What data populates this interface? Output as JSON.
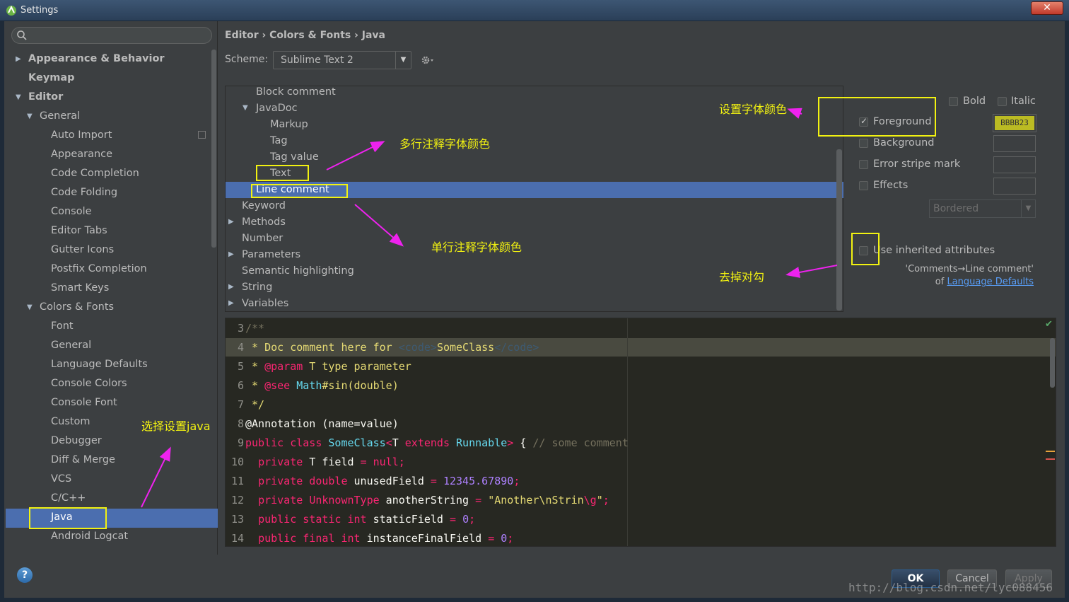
{
  "window": {
    "title": "Settings",
    "close_glyph": "✕"
  },
  "search": {
    "placeholder": ""
  },
  "tree": {
    "items": [
      {
        "label": "Appearance & Behavior",
        "bold": true,
        "level": 0,
        "arrow": "▶"
      },
      {
        "label": "Keymap",
        "bold": true,
        "level": 0,
        "arrow": ""
      },
      {
        "label": "Editor",
        "bold": true,
        "level": 0,
        "arrow": "▼"
      },
      {
        "label": "General",
        "bold": false,
        "level": 1,
        "arrow": "▼"
      },
      {
        "label": "Auto Import",
        "level": 2
      },
      {
        "label": "Appearance",
        "level": 2
      },
      {
        "label": "Code Completion",
        "level": 2
      },
      {
        "label": "Code Folding",
        "level": 2
      },
      {
        "label": "Console",
        "level": 2
      },
      {
        "label": "Editor Tabs",
        "level": 2
      },
      {
        "label": "Gutter Icons",
        "level": 2
      },
      {
        "label": "Postfix Completion",
        "level": 2
      },
      {
        "label": "Smart Keys",
        "level": 2
      },
      {
        "label": "Colors & Fonts",
        "level": 1,
        "arrow": "▼"
      },
      {
        "label": "Font",
        "level": 2
      },
      {
        "label": "General",
        "level": 2
      },
      {
        "label": "Language Defaults",
        "level": 2
      },
      {
        "label": "Console Colors",
        "level": 2
      },
      {
        "label": "Console Font",
        "level": 2
      },
      {
        "label": "Custom",
        "level": 2
      },
      {
        "label": "Debugger",
        "level": 2
      },
      {
        "label": "Diff & Merge",
        "level": 2
      },
      {
        "label": "VCS",
        "level": 2
      },
      {
        "label": "C/C++",
        "level": 2
      },
      {
        "label": "Java",
        "level": 2,
        "selected": true
      },
      {
        "label": "Android Logcat",
        "level": 2
      }
    ]
  },
  "breadcrumb": "Editor › Colors & Fonts › Java",
  "scheme": {
    "label": "Scheme:",
    "value": "Sublime Text 2"
  },
  "attributes": [
    {
      "label": "Block comment",
      "indent": 2
    },
    {
      "label": "JavaDoc",
      "indent": 2,
      "arrow": "▼"
    },
    {
      "label": "Markup",
      "indent": 3
    },
    {
      "label": "Tag",
      "indent": 3
    },
    {
      "label": "Tag value",
      "indent": 3
    },
    {
      "label": "Text",
      "indent": 3
    },
    {
      "label": "Line comment",
      "indent": 2,
      "selected": true
    },
    {
      "label": "Keyword",
      "indent": 1
    },
    {
      "label": "Methods",
      "indent": 1,
      "arrow": "▶"
    },
    {
      "label": "Number",
      "indent": 1
    },
    {
      "label": "Parameters",
      "indent": 1,
      "arrow": "▶"
    },
    {
      "label": "Semantic highlighting",
      "indent": 1
    },
    {
      "label": "String",
      "indent": 1,
      "arrow": "▶"
    },
    {
      "label": "Variables",
      "indent": 1,
      "arrow": "▶"
    }
  ],
  "options": {
    "bold": "Bold",
    "italic": "Italic",
    "foreground": "Foreground",
    "foreground_color": "BBBB23",
    "background": "Background",
    "error_stripe": "Error stripe mark",
    "effects": "Effects",
    "effects_type": "Bordered",
    "use_inherited": "Use inherited attributes",
    "inherit_note_1": "'Comments→Line comment'",
    "inherit_note_of": "of",
    "inherit_link": "Language Defaults"
  },
  "preview_lines": [
    {
      "n": "3",
      "html": "<span class=\"cm2\">/**</span>"
    },
    {
      "n": "4",
      "html": "<span class=\"cm\"> * Doc comment here for </span><span class=\"tg\">&lt;code&gt;</span><span class=\"cm\">SomeClass</span><span class=\"tg\">&lt;/code&gt;</span>"
    },
    {
      "n": "5",
      "html": "<span class=\"cm\"> * </span><span class=\"kw\">@param</span><span class=\"cm\"> T type parameter</span>"
    },
    {
      "n": "6",
      "html": "<span class=\"cm\"> * </span><span class=\"kw\">@see</span><span class=\"cm\"> </span><span class=\"ty\">Math</span><span class=\"cm\">#sin(double)</span>"
    },
    {
      "n": "7",
      "html": "<span class=\"cm\"> */</span>"
    },
    {
      "n": "8",
      "html": "@Annotation (name=value)"
    },
    {
      "n": "9",
      "html": "<span class=\"kw\">public class</span> <span class=\"ty\">SomeClass</span><span class=\"kw\">&lt;</span>T <span class=\"kw\">extends</span> <span class=\"ty\">Runnable</span><span class=\"kw\">&gt;</span> { <span class=\"cm2\">// some comment</span>"
    },
    {
      "n": "10",
      "html": "  <span class=\"kw\">private</span> T field <span class=\"kw\">=</span> <span class=\"kw\">null;</span>"
    },
    {
      "n": "11",
      "html": "  <span class=\"kw\">private double</span> unusedField <span class=\"kw\">=</span> <span class=\"nm\">12345.67890</span><span class=\"kw\">;</span>"
    },
    {
      "n": "12",
      "html": "  <span class=\"kw\">private</span> <span class=\"kw\">UnknownType</span> anotherString <span class=\"kw\">=</span> <span class=\"st\">\"Another\\nStrin</span><span class=\"kw\">\\g</span><span class=\"st\">\"</span><span class=\"kw\">;</span>"
    },
    {
      "n": "13",
      "html": "  <span class=\"kw\">public static int</span> staticField <span class=\"kw\">=</span> <span class=\"nm\">0</span><span class=\"kw\">;</span>"
    },
    {
      "n": "14",
      "html": "  <span class=\"kw\">public final int</span> instanceFinalField <span class=\"kw\">=</span> <span class=\"nm\">0</span><span class=\"kw\">;</span>"
    }
  ],
  "buttons": {
    "help": "?",
    "ok": "OK",
    "cancel": "Cancel",
    "apply": "Apply"
  },
  "watermark": "http://blog.csdn.net/lyc088456",
  "annotations": {
    "font_color": "设置字体颜色",
    "multiline": "多行注释字体颜色",
    "singleline": "单行注释字体颜色",
    "uncheck": "去掉对勾",
    "select_java": "选择设置java"
  },
  "colors": {
    "accent": "#4b6eaf",
    "annotation": "#f2f211",
    "arrow": "#ee22ee",
    "foreground_swatch": "#bbbb23"
  }
}
